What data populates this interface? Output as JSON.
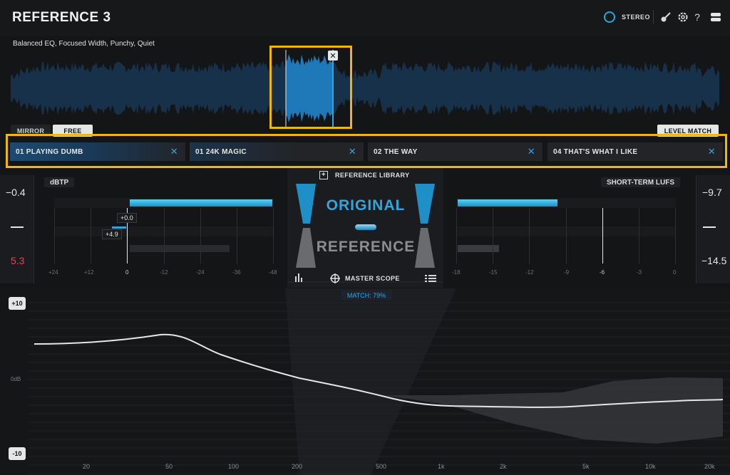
{
  "header": {
    "title": "REFERENCE 3",
    "stereo_label": "STEREO",
    "help_label": "?"
  },
  "tags": "Balanced EQ,  Focused Width,  Punchy,  Quiet",
  "waveform": {
    "close_label": "✕",
    "mirror_label": "MIRROR",
    "free_label": "FREE",
    "level_match_label": "LEVEL MATCH"
  },
  "tracks": [
    {
      "label": "01 PLAYING DUMB",
      "close": "✕"
    },
    {
      "label": "01 24K MAGIC",
      "close": "✕"
    },
    {
      "label": "02 THE WAY",
      "close": "✕"
    },
    {
      "label": "04 THAT'S WHAT I LIKE",
      "close": "✕"
    }
  ],
  "side_readouts": {
    "left_top": "−0.4",
    "left_bottom": "5.3",
    "right_top": "−9.7",
    "right_bottom": "−14.5"
  },
  "meters": {
    "dbtp_label": "dBTP",
    "lufs_label": "SHORT-TERM LUFS",
    "left_ticks": [
      "+24",
      "+12",
      "0",
      "-12",
      "-24",
      "-36",
      "-48"
    ],
    "right_ticks": [
      "-18",
      "-15",
      "-12",
      "-9",
      "-6",
      "-3",
      "0"
    ],
    "left_badge_top": "+0.0",
    "left_badge_bottom": "+4.9"
  },
  "center": {
    "reference_library_label": "REFERENCE LIBRARY",
    "original_label": "ORIGINAL",
    "reference_label": "REFERENCE",
    "master_scope_label": "MASTER SCOPE",
    "match_label": "MATCH:  79%"
  },
  "eq": {
    "top_label": "+10",
    "zero_label": "0dB",
    "bottom_label": "-10",
    "freq_labels": [
      "20",
      "50",
      "100",
      "200",
      "500",
      "1k",
      "2k",
      "5k",
      "10k",
      "20k"
    ]
  },
  "colors": {
    "accent": "#2ea7e0",
    "highlight": "#f2b705",
    "negative": "#e0455d"
  }
}
